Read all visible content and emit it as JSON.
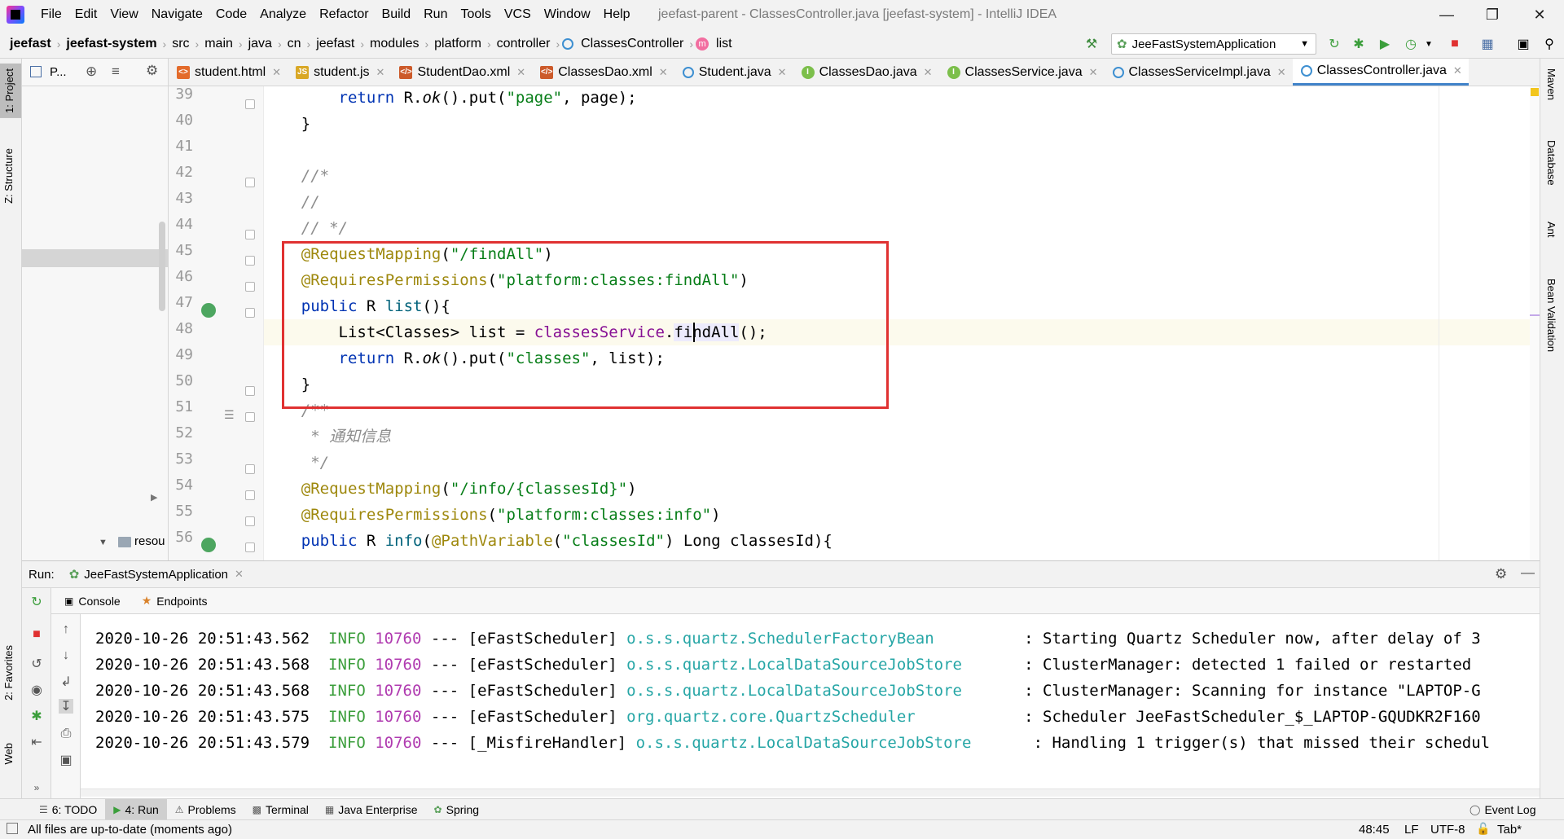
{
  "menu": [
    "File",
    "Edit",
    "View",
    "Navigate",
    "Code",
    "Analyze",
    "Refactor",
    "Build",
    "Run",
    "Tools",
    "VCS",
    "Window",
    "Help"
  ],
  "window_title": "jeefast-parent - ClassesController.java [jeefast-system] - IntelliJ IDEA",
  "breadcrumb": [
    "jeefast",
    "jeefast-system",
    "src",
    "main",
    "java",
    "cn",
    "jeefast",
    "modules",
    "platform",
    "controller",
    "ClassesController",
    "list"
  ],
  "run_config": "JeeFastSystemApplication",
  "project_panel_label": "P...",
  "left_tabs": {
    "project": "1: Project",
    "structure": "Z: Structure",
    "favorites": "2: Favorites",
    "web": "Web"
  },
  "right_tabs": [
    "Maven",
    "Database",
    "Ant",
    "Bean Validation"
  ],
  "editor_tabs": [
    {
      "name": "student.html",
      "icon": "html-file-icon"
    },
    {
      "name": "student.js",
      "icon": "js-file-icon"
    },
    {
      "name": "StudentDao.xml",
      "icon": "xml-file-icon"
    },
    {
      "name": "ClassesDao.xml",
      "icon": "xml-file-icon"
    },
    {
      "name": "Student.java",
      "icon": "class-icon"
    },
    {
      "name": "ClassesDao.java",
      "icon": "interface-icon"
    },
    {
      "name": "ClassesService.java",
      "icon": "interface-icon"
    },
    {
      "name": "ClassesServiceImpl.java",
      "icon": "class-icon"
    },
    {
      "name": "ClassesController.java",
      "icon": "class-icon",
      "active": true
    }
  ],
  "line_numbers": [
    "39",
    "40",
    "41",
    "42",
    "43",
    "44",
    "45",
    "46",
    "47",
    "48",
    "49",
    "50",
    "51",
    "52",
    "53",
    "54",
    "55",
    "56"
  ],
  "code": {
    "l39": [
      "        ",
      "return",
      " R.",
      "ok",
      "().put(",
      "\"page\"",
      ", page);"
    ],
    "l40": "    }",
    "l42": "    //*",
    "l43": "    //",
    "l44": "    // */",
    "l45": [
      "    ",
      "@RequestMapping",
      "(",
      "\"/findAll\"",
      ")"
    ],
    "l46": [
      "    ",
      "@RequiresPermissions",
      "(",
      "\"platform:classes:findAll\"",
      ")"
    ],
    "l47": [
      "    ",
      "public",
      " R ",
      "list",
      "(){"
    ],
    "l48": [
      "        List<Classes> list = ",
      "classesService",
      ".",
      "findAll",
      "();"
    ],
    "l49": [
      "        ",
      "return",
      " R.",
      "ok",
      "().put(",
      "\"classes\"",
      ", list);"
    ],
    "l50": "    }",
    "l51": "    /**",
    "l52": "     * 通知信息",
    "l53": "     */",
    "l54": [
      "    ",
      "@RequestMapping",
      "(",
      "\"/info/{classesId}\"",
      ")"
    ],
    "l55": [
      "    ",
      "@RequiresPermissions",
      "(",
      "\"platform:classes:info\"",
      ")"
    ],
    "l56": [
      "    ",
      "public",
      " R ",
      "info",
      "(",
      "@PathVariable",
      "(",
      "\"classesId\"",
      ") Long classesId){"
    ]
  },
  "project_tree_item": "resou",
  "run": {
    "label": "Run:",
    "tab": "JeeFastSystemApplication",
    "subtabs": [
      "Console",
      "Endpoints"
    ]
  },
  "console": [
    {
      "ts": "2020-10-26 20:51:43.562",
      "level": "INFO",
      "pid": "10760",
      "sep": "---",
      "thread": "[eFastScheduler]",
      "cls": "o.s.s.quartz.SchedulerFactoryBean",
      "msg": ": Starting Quartz Scheduler now, after delay of 3"
    },
    {
      "ts": "2020-10-26 20:51:43.568",
      "level": "INFO",
      "pid": "10760",
      "sep": "---",
      "thread": "[eFastScheduler]",
      "cls": "o.s.s.quartz.LocalDataSourceJobStore",
      "msg": ": ClusterManager: detected 1 failed or restarted"
    },
    {
      "ts": "2020-10-26 20:51:43.568",
      "level": "INFO",
      "pid": "10760",
      "sep": "---",
      "thread": "[eFastScheduler]",
      "cls": "o.s.s.quartz.LocalDataSourceJobStore",
      "msg": ": ClusterManager: Scanning for instance \"LAPTOP-G"
    },
    {
      "ts": "2020-10-26 20:51:43.575",
      "level": "INFO",
      "pid": "10760",
      "sep": "---",
      "thread": "[eFastScheduler]",
      "cls": "org.quartz.core.QuartzScheduler",
      "msg": ": Scheduler JeeFastScheduler_$_LAPTOP-GQUDKR2F160"
    },
    {
      "ts": "2020-10-26 20:51:43.579",
      "level": "INFO",
      "pid": "10760",
      "sep": "---",
      "thread": "[_MisfireHandler]",
      "cls": "o.s.s.quartz.LocalDataSourceJobStore",
      "msg": ": Handling 1 trigger(s) that missed their schedul"
    }
  ],
  "bottom_tools": [
    {
      "label": "6: TODO",
      "icon": "todo-icon"
    },
    {
      "label": "4: Run",
      "icon": "run-icon",
      "active": true
    },
    {
      "label": "Problems",
      "icon": "problems-icon"
    },
    {
      "label": "Terminal",
      "icon": "terminal-icon"
    },
    {
      "label": "Java Enterprise",
      "icon": "java-enterprise-icon"
    },
    {
      "label": "Spring",
      "icon": "spring-icon"
    }
  ],
  "event_log": "Event Log",
  "status": {
    "message": "All files are up-to-date (moments ago)",
    "position": "48:45",
    "line_sep": "LF",
    "encoding": "UTF-8",
    "indent": "Tab*"
  },
  "colors": {
    "highlight_box": "#e03131",
    "keyword": "#0033b3",
    "string": "#067d17",
    "annotation": "#9e880d",
    "accent": "#4083c9"
  }
}
